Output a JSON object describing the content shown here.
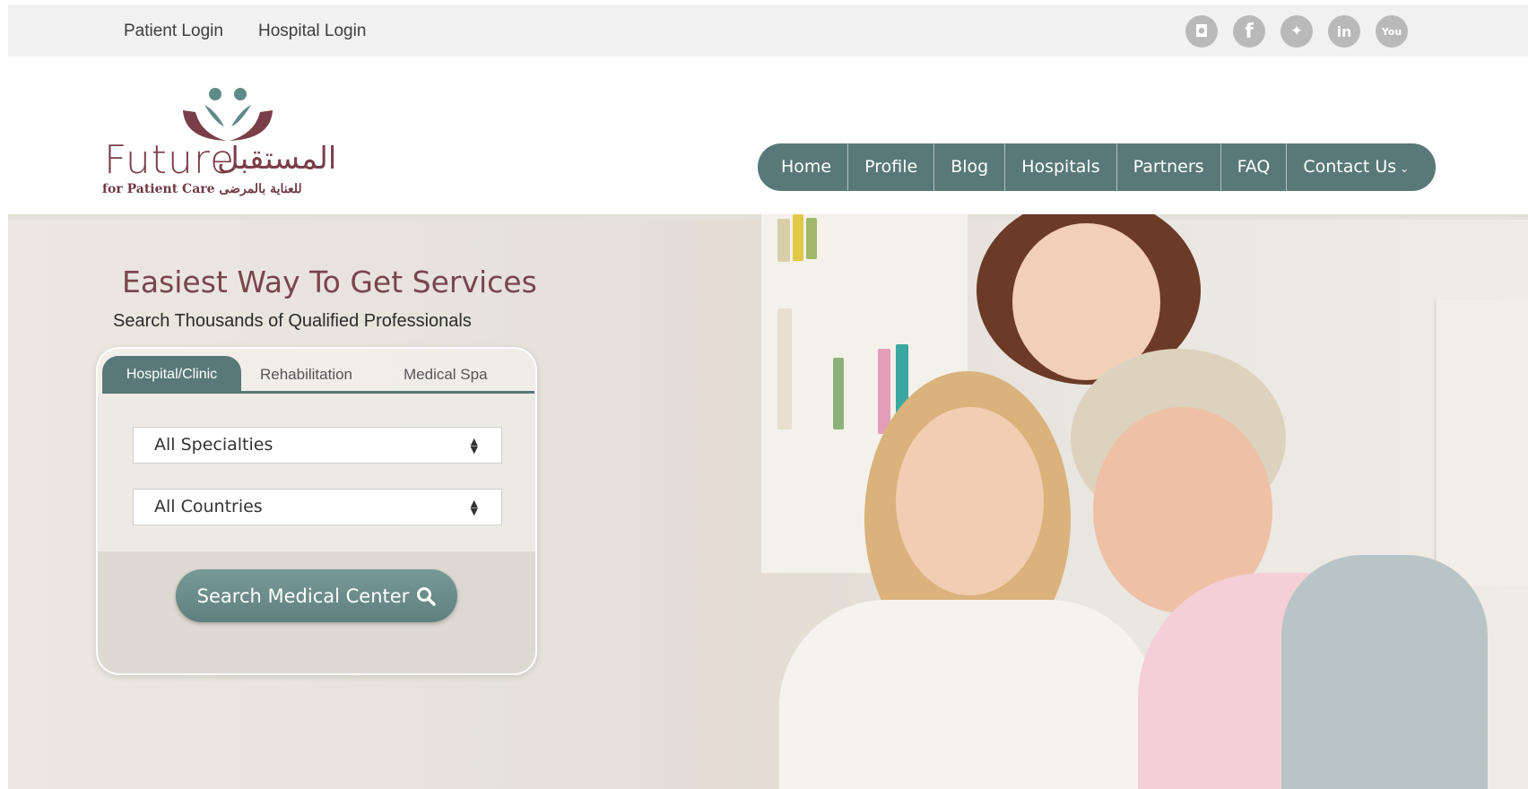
{
  "topbar": {
    "patient_login": "Patient Login",
    "hospital_login": "Hospital Login",
    "social": [
      {
        "icon": "instagram-icon",
        "glyph": "◘"
      },
      {
        "icon": "facebook-icon",
        "glyph": "f"
      },
      {
        "icon": "twitter-icon",
        "glyph": "✦"
      },
      {
        "icon": "linkedin-icon",
        "glyph": "in"
      },
      {
        "icon": "youtube-icon",
        "glyph": "You"
      }
    ]
  },
  "logo": {
    "future": "Future",
    "arabic": "المستقبل",
    "subtitle": "for Patient Care للعناية بالمرضى"
  },
  "nav": {
    "items": [
      "Home",
      "Profile",
      "Blog",
      "Hospitals",
      "Partners",
      "FAQ",
      "Contact Us"
    ]
  },
  "hero": {
    "title": "Easiest Way To Get Services",
    "subtitle": "Search Thousands of Qualified Professionals"
  },
  "search": {
    "tabs": [
      "Hospital/Clinic",
      "Rehabilitation",
      "Medical Spa"
    ],
    "specialties": "All Specialties",
    "countries": "All Countries",
    "button": "Search Medical Center"
  },
  "colors": {
    "accent": "#587977",
    "brand": "#7a3e48",
    "topbar": "#f1f1f1"
  }
}
